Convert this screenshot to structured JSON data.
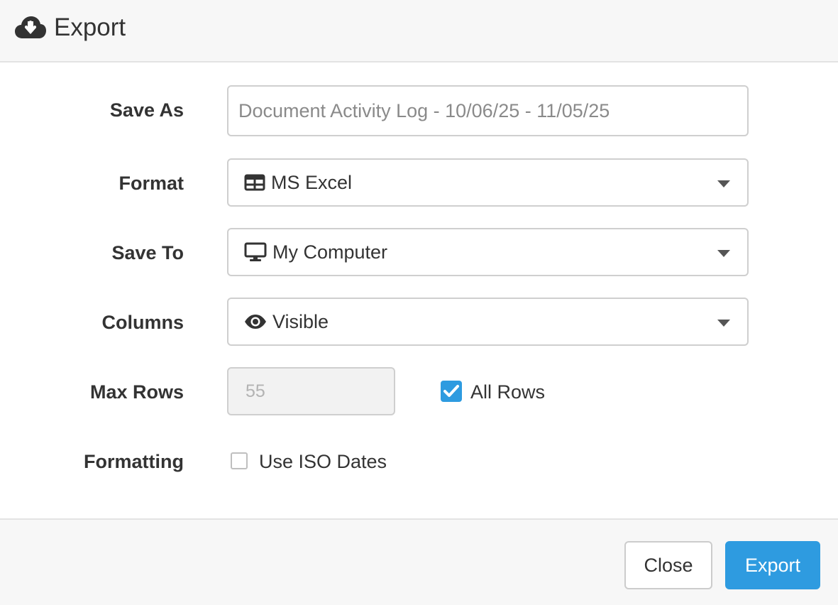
{
  "dialog": {
    "title": "Export",
    "icon": "cloud-download-icon"
  },
  "form": {
    "save_as": {
      "label": "Save As",
      "value": "Document Activity Log - 10/06/25 - 11/05/25"
    },
    "format": {
      "label": "Format",
      "selected": "MS Excel",
      "icon": "table-icon"
    },
    "save_to": {
      "label": "Save To",
      "selected": "My Computer",
      "icon": "desktop-icon"
    },
    "columns": {
      "label": "Columns",
      "selected": "Visible",
      "icon": "eye-icon"
    },
    "max_rows": {
      "label": "Max Rows",
      "value": "55",
      "disabled": true
    },
    "all_rows": {
      "label": "All Rows",
      "checked": true
    },
    "formatting": {
      "label": "Formatting",
      "iso_dates_label": "Use ISO Dates",
      "iso_dates_checked": false
    }
  },
  "footer": {
    "close_label": "Close",
    "export_label": "Export"
  },
  "colors": {
    "primary": "#2e9be0",
    "header_bg": "#f7f7f7",
    "border": "#cfcfcf",
    "text": "#333333"
  }
}
